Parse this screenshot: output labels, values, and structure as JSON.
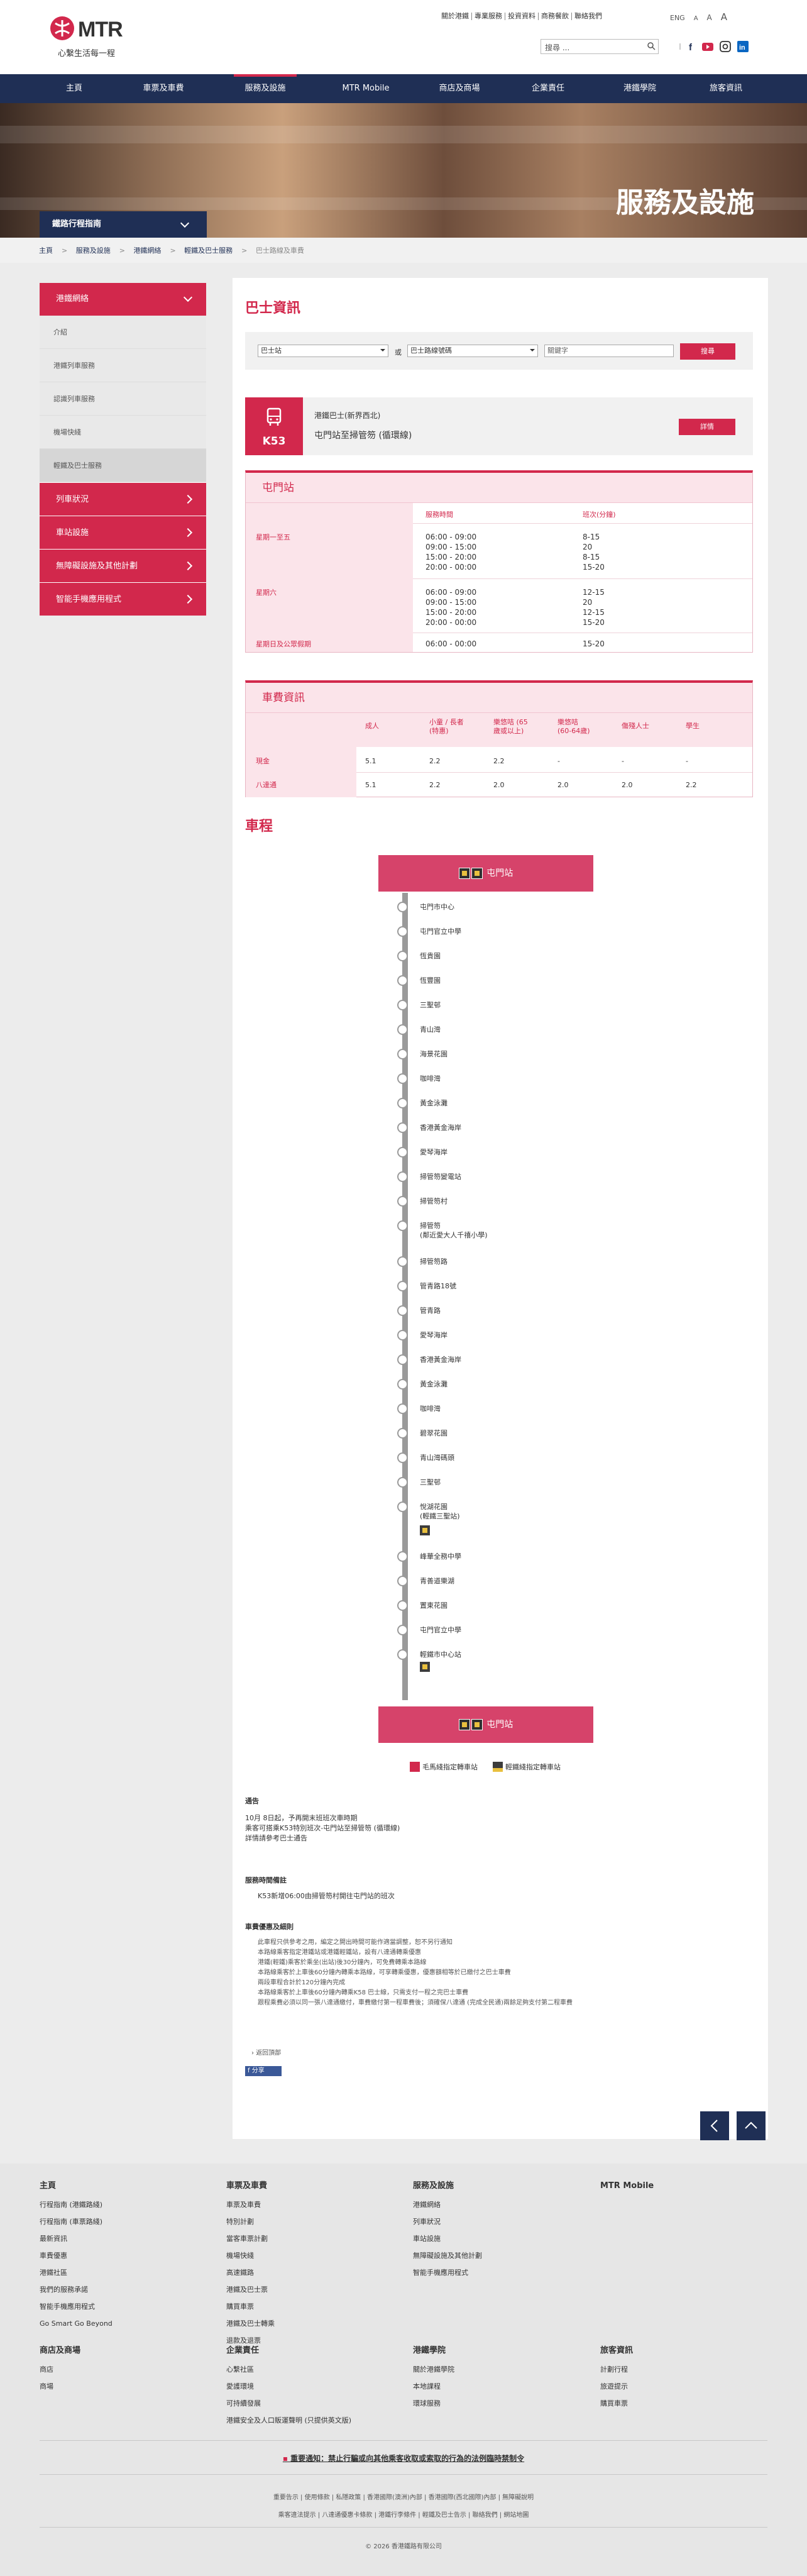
{
  "header": {
    "logo_text": "MTR",
    "slogan": "心繫生活每一程",
    "top_links": [
      "關於港鐵",
      "專業服務",
      "投資資料",
      "商務餐飲",
      "聯絡我們"
    ],
    "lang": "ENG",
    "font_sizes": [
      "A",
      "A",
      "A"
    ],
    "search_placeholder": "搜尋 ..."
  },
  "nav": [
    "主頁",
    "車票及車費",
    "服務及設施",
    "MTR Mobile",
    "商店及商場",
    "企業責任",
    "港鐵學院",
    "旅客資訊"
  ],
  "banner": {
    "title": "服務及設施",
    "plan_label": "鐵路行程指南"
  },
  "breadcrumb": [
    "主頁",
    "服務及設施",
    "港鐵網絡",
    "輕鐵及巴士服務",
    "巴士路線及車費"
  ],
  "sidebar": {
    "top": "港鐵網絡",
    "subs": [
      "介紹",
      "港鐵列車服務",
      "認識列車服務",
      "機場快綫",
      "輕鐵及巴士服務"
    ],
    "mains": [
      "列車狀況",
      "車站設施",
      "無障礙設施及其他計劃",
      "智能手機應用程式"
    ]
  },
  "bus_info": {
    "heading": "巴士資訊",
    "sel_district": "巴士站",
    "or_text": "或",
    "sel_route": "巴士路線號碼",
    "keyword_placeholder": "關鍵字",
    "search_btn": "搜尋",
    "route_no": "K53",
    "operator": "港鐵巴士(新界西北)",
    "route_name": "屯門站至掃管笏 (循環線)",
    "detail_btn": "詳情"
  },
  "timetable": {
    "title": "屯門站",
    "col_time": "服務時間",
    "col_freq": "班次(分鐘)",
    "rows": [
      {
        "day": "星期一至五",
        "times": "06:00 - 09:00\n09:00 - 15:00\n15:00 - 20:00\n20:00 - 00:00",
        "freq": "8-15\n20\n8-15\n15-20"
      },
      {
        "day": "星期六",
        "times": "06:00 - 09:00\n09:00 - 15:00\n15:00 - 20:00\n20:00 - 00:00",
        "freq": "12-15\n20\n12-15\n15-20"
      },
      {
        "day": "星期日及公眾假期",
        "times": "06:00 - 00:00",
        "freq": "15-20"
      }
    ]
  },
  "fares": {
    "title": "車費資訊",
    "headers": [
      "成人",
      "小童 / 長者\n(特惠)",
      "樂悠咭 (65\n歲或以上)",
      "樂悠咭\n(60-64歲)",
      "傷殘人士",
      "學生"
    ],
    "rows": [
      {
        "type": "現金",
        "vals": [
          "5.1",
          "2.2",
          "2.2",
          "-",
          "-",
          "-"
        ]
      },
      {
        "type": "八達通",
        "vals": [
          "5.1",
          "2.2",
          "2.0",
          "2.0",
          "2.0",
          "2.2"
        ]
      }
    ]
  },
  "journey": {
    "heading": "車程",
    "start": "屯門站",
    "end": "屯門站",
    "stops": [
      "屯門市中心",
      "屯門官立中學",
      "恆貴園",
      "恆豐園",
      "三聖邨",
      "青山灣",
      "海景花園",
      "咖啡灣",
      "黃金泳灘",
      "香港黃金海岸",
      "愛琴海岸",
      "掃管笏變電站",
      "掃管笏村",
      "掃管笏\n(鄰近愛大人千禧小學)",
      "掃管笏路",
      "管青路18號",
      "管青路",
      "愛琴海岸",
      "香港黃金海岸",
      "黃金泳灘",
      "咖啡灣",
      "碧翠花園",
      "青山灣碼頭",
      "三聖邨",
      "悅湖花園\n(輕鐵三聖站)",
      "峰華全務中學",
      "青善道樂湖",
      "置東花園",
      "屯門官立中學",
      "輕鐵市中心站"
    ],
    "legend_a": "毛馬綫指定轉車站",
    "legend_b": "輕鐵綫指定轉車站"
  },
  "notes": {
    "n1_h": "通告",
    "n1_t": "10月 8日起，予再開末班班次車時期\n乘客可搭乘K53特別班次-屯門站至掃管笏 (循環線)\n詳情請參考巴士通告",
    "n2_h": "服務時間備註",
    "n2_t": "K53新增06:00由掃管笏村開往屯門站的班次",
    "n3_h": "車費優惠及細則",
    "n3_t": "此車程只供參考之用，編定之開出時間可能作適當調整，恕不另行通知\n本路線乘客指定港鐵站或港鐵輕鐵站，設有八達通轉乘優惠\n港鐵(輕鐵)乘客於乘坐(出站)後30分鐘內，可免費轉乘本路線\n本路線乘客於上車後60分鐘內轉乘本路線，可享轉乘優惠，優惠額相等於已繳付之巴士車費\n兩段車程合計於120分鐘內完成\n本路線乘客於上車後60分鐘內轉乘K58 巴士線，只需支付一程之完巴士車費\n跟程乘費必須以同一張八達通繳付，車費繳付第一程車費後；須確保八達通 (完成全民通)兩餘足夠支付第二程車費",
    "back": "返回頂部",
    "share": "分享"
  },
  "footer": {
    "cols": [
      {
        "h": "主頁",
        "items": [
          "行程指南 (港鐵路綫)",
          "行程指南 (車票路綫)",
          "最新資訊",
          "車費優惠",
          "港鐵社區",
          "我們的服務承諾",
          "智能手機應用程式",
          "Go Smart Go Beyond"
        ]
      },
      {
        "h": "車票及車費",
        "items": [
          "車票及車費",
          "特別計劃",
          "當客車票計劃",
          "機場快綫",
          "高速鐵路",
          "港鐵及巴士票",
          "購買車票",
          "港鐵及巴士轉乘",
          "退款及退票"
        ]
      },
      {
        "h": "服務及設施",
        "items": [
          "港鐵網絡",
          "列車狀況",
          "車站設施",
          "無障礙設施及其他計劃",
          "智能手機應用程式"
        ]
      },
      {
        "h": "MTR Mobile",
        "items": []
      },
      {
        "h": "商店及商場",
        "items": [
          "商店",
          "商場"
        ]
      },
      {
        "h": "企業責任",
        "items": [
          "心繫社區",
          "愛護環境",
          "可持續發展",
          "港鐵安全及人口販運聲明 (只提供英文版)"
        ]
      },
      {
        "h": "港鐵學院",
        "items": [
          "關於港鐵學院",
          "本地課程",
          "環球服務"
        ]
      },
      {
        "h": "旅客資訊",
        "items": [
          "計劃行程",
          "旅遊提示",
          "購買車票"
        ]
      }
    ],
    "notice": "重要通知：禁止行騙或向其他乘客收取或索取的行為的法例臨時禁制令",
    "links1": [
      "重要告示",
      "使用條款",
      "私隱政策",
      "香港國際(澳洲)內部",
      "香港國際(西北國際)內部",
      "無障礙說明"
    ],
    "links2": [
      "乘客違法提示",
      "八達通優惠卡條款",
      "港鐵行李條件",
      "輕鐵及巴士告示",
      "聯絡我們",
      "網站地圖"
    ],
    "copyright": "© 2026 香港鐵路有限公司"
  },
  "colors": {
    "brand_red": "#d2284c",
    "navy": "#1f2f55",
    "pink_bg": "#fbe4ea"
  }
}
